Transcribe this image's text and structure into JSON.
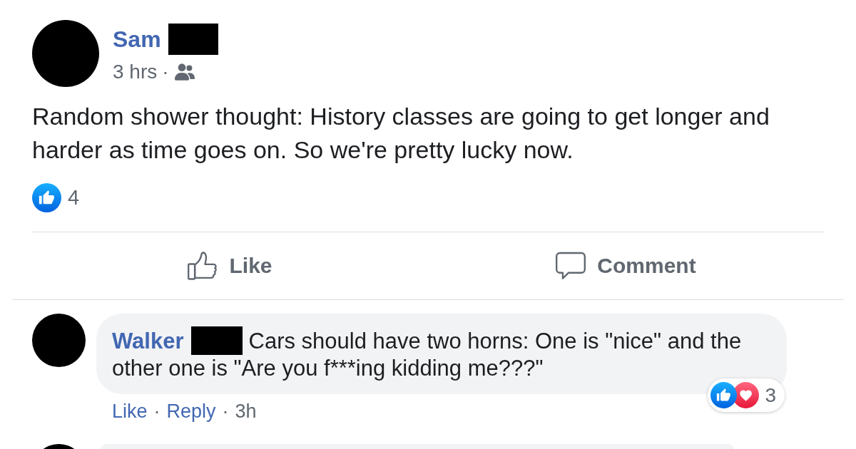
{
  "post": {
    "author": {
      "name": "Sam",
      "surname_redacted": true
    },
    "meta": [
      {
        "kind": "time",
        "label": "3 hrs"
      },
      {
        "kind": "separator",
        "label": "·"
      }
    ],
    "text": "Random shower thought: History classes are going to get longer and harder as time goes on. So we're pretty lucky now.",
    "reactions": {
      "icons": [
        {
          "kind": "like"
        }
      ],
      "count": "4"
    },
    "actions": [
      {
        "kind": "like",
        "label": "Like"
      },
      {
        "kind": "comment",
        "label": "Comment"
      }
    ]
  },
  "comments": [
    {
      "kind": "comment",
      "author": {
        "name": "Walker",
        "surname_redacted": true
      },
      "text_lines": [
        "Cars should have two horns: One is \"nice\" and the",
        "other one is \"Are you f***ing kidding me???\""
      ],
      "reactions": {
        "icons": [
          {
            "kind": "like"
          },
          {
            "kind": "love"
          }
        ],
        "count": "3"
      },
      "footer": [
        {
          "kind": "link",
          "label": "Like"
        },
        {
          "kind": "separator",
          "label": "·"
        },
        {
          "kind": "link",
          "label": "Reply"
        },
        {
          "kind": "separator",
          "label": "·"
        },
        {
          "kind": "time",
          "label": "3h"
        }
      ]
    },
    {
      "kind": "partial"
    }
  ]
}
